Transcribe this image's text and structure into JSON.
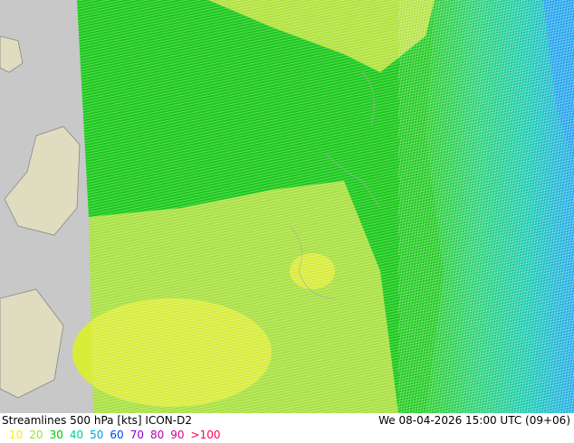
{
  "header": {
    "title": "Streamlines 500 hPa [kts] ICON-D2",
    "valid_time": "We 08-04-2026 15:00 UTC (09+06)"
  },
  "legend": [
    {
      "label": "10",
      "color": "#f5f200"
    },
    {
      "label": "20",
      "color": "#99e630"
    },
    {
      "label": "30",
      "color": "#00c800"
    },
    {
      "label": "40",
      "color": "#00d096"
    },
    {
      "label": "50",
      "color": "#00a0e6"
    },
    {
      "label": "60",
      "color": "#0046f0"
    },
    {
      "label": "70",
      "color": "#8c00d2"
    },
    {
      "label": "80",
      "color": "#b400b4"
    },
    {
      "label": "90",
      "color": "#d20096"
    },
    {
      "label": ">100",
      "color": "#ff0050"
    }
  ],
  "colors": {
    "outside_domain": "#c8c8c8",
    "land": "#e8e4c8"
  }
}
